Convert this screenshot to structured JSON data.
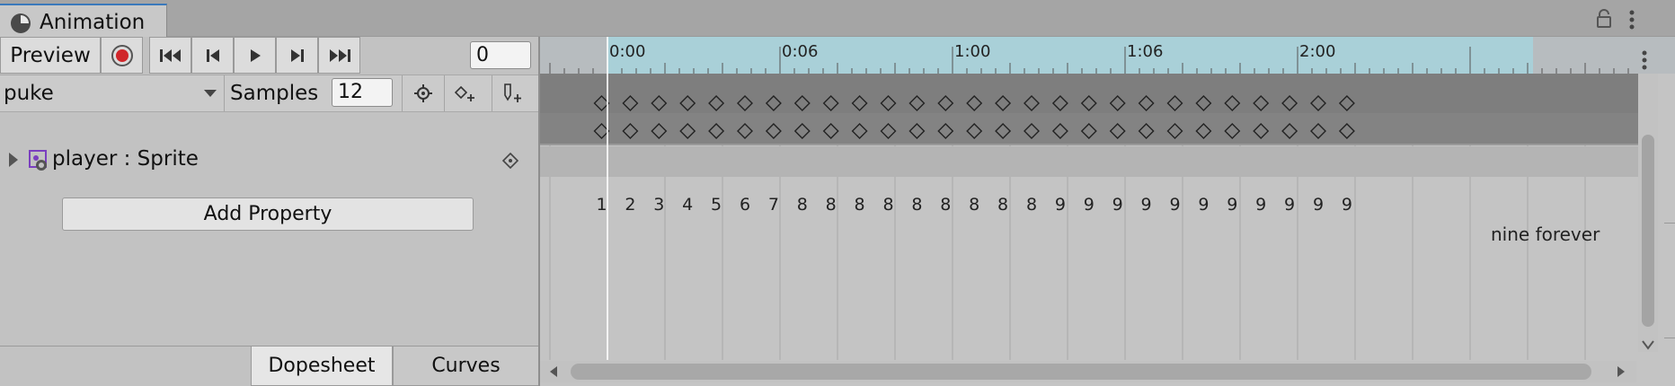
{
  "window": {
    "tab_title": "Animation",
    "tab_icon": "clock-icon"
  },
  "toolbar": {
    "preview_label": "Preview",
    "frame_value": "0",
    "record_color": "#d0262a"
  },
  "clip": {
    "name": "puke",
    "samples_label": "Samples",
    "samples_value": "12"
  },
  "properties": [
    {
      "label": "player : Sprite",
      "icon": "sprite-renderer-icon"
    }
  ],
  "add_property_label": "Add Property",
  "bottom_tabs": {
    "dopesheet": "Dopesheet",
    "curves": "Curves"
  },
  "timeline": {
    "ruler_labels": [
      "0:00",
      "0:06",
      "1:00",
      "1:06",
      "2:00"
    ],
    "ruler_color": "#a9d0d8",
    "keyframe_count": 27,
    "frame_numbers": [
      "1",
      "2",
      "3",
      "4",
      "5",
      "6",
      "7",
      "8",
      "8",
      "8",
      "8",
      "8",
      "8",
      "8",
      "8",
      "8",
      "9",
      "9",
      "9",
      "9",
      "9",
      "9",
      "9",
      "9",
      "9",
      "9",
      "9"
    ],
    "annotation": "nine forever"
  }
}
